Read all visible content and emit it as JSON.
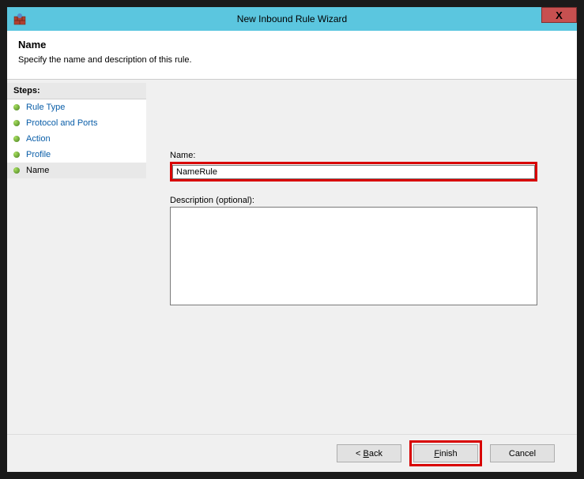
{
  "titlebar": {
    "title": "New Inbound Rule Wizard",
    "close": "X"
  },
  "header": {
    "title": "Name",
    "subtitle": "Specify the name and description of this rule."
  },
  "sidebar": {
    "steps_header": "Steps:",
    "items": [
      {
        "label": "Rule Type",
        "active": false
      },
      {
        "label": "Protocol and Ports",
        "active": false
      },
      {
        "label": "Action",
        "active": false
      },
      {
        "label": "Profile",
        "active": false
      },
      {
        "label": "Name",
        "active": true
      }
    ]
  },
  "form": {
    "name_label": "Name:",
    "name_value": "NameRule",
    "desc_label": "Description (optional):",
    "desc_value": ""
  },
  "footer": {
    "back": "< Back",
    "finish": "Finish",
    "cancel": "Cancel"
  }
}
